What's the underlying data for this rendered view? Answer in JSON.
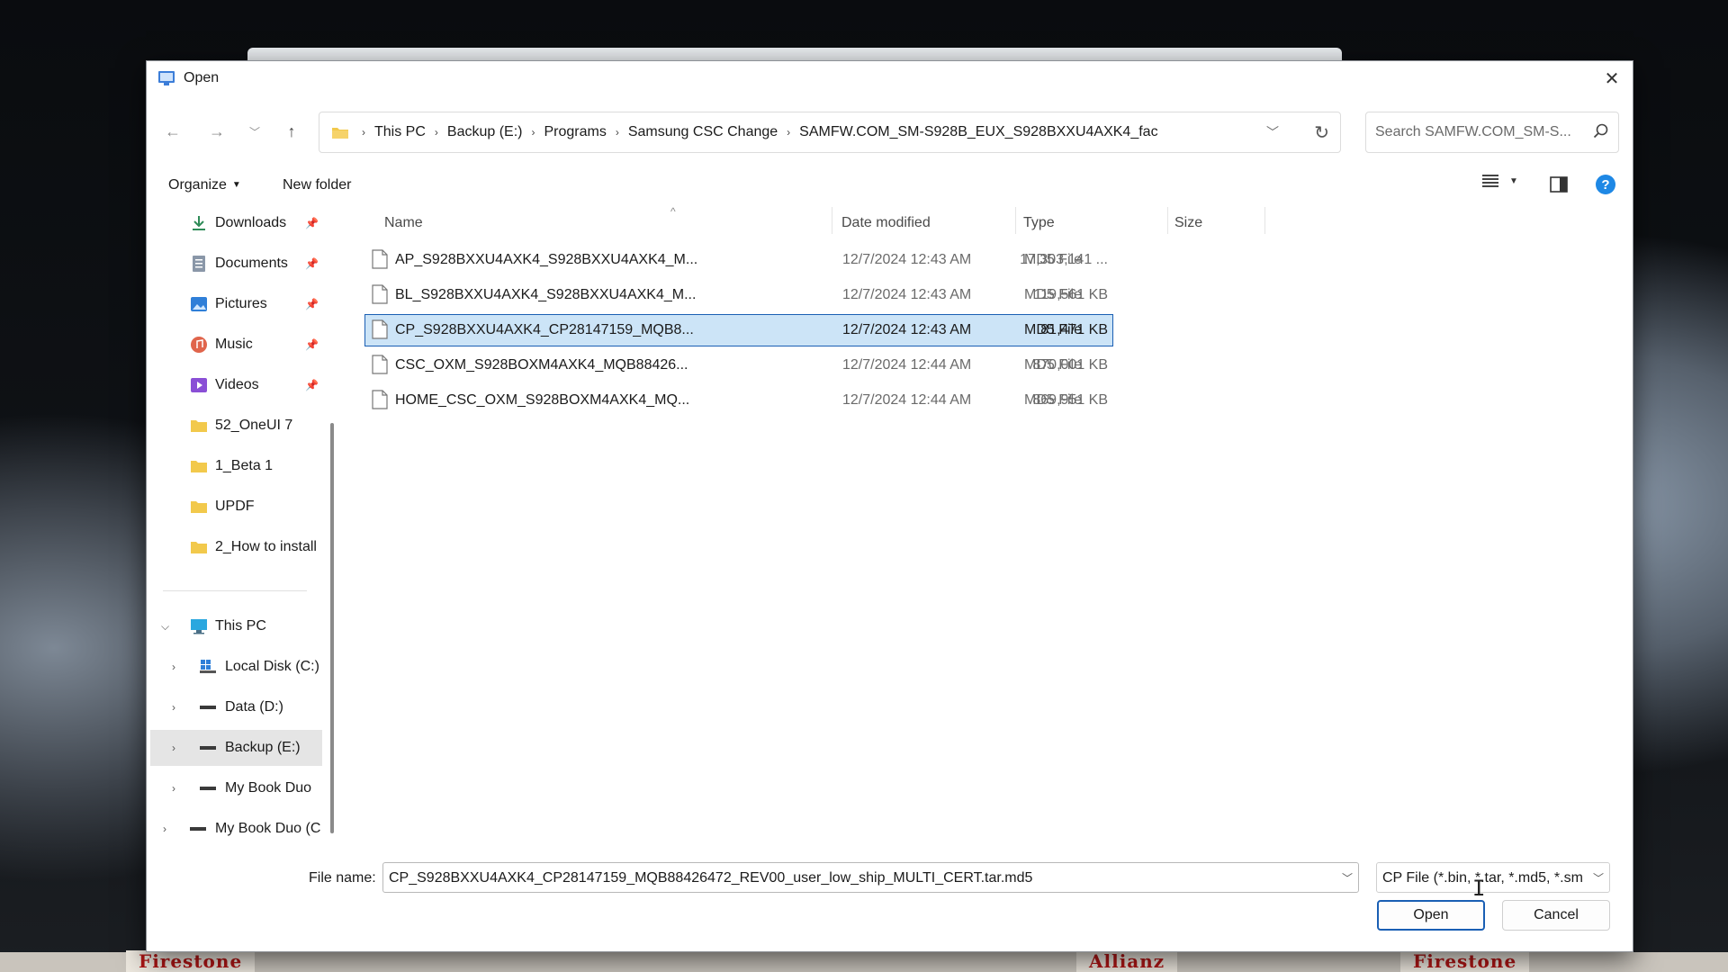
{
  "window": {
    "title": "Open"
  },
  "background": {
    "brand_left": "Firestone",
    "brand_center": "Allianz",
    "brand_right": "Firestone"
  },
  "address_bar": {
    "crumbs": [
      "This PC",
      "Backup (E:)",
      "Programs",
      "Samsung CSC Change",
      "SAMFW.COM_SM-S928B_EUX_S928BXXU4AXK4_fac"
    ]
  },
  "search": {
    "placeholder": "Search SAMFW.COM_SM-S..."
  },
  "commands": {
    "organize": "Organize",
    "new_folder": "New folder"
  },
  "sidebar": {
    "quick": [
      {
        "label": "Downloads",
        "icon": "download-icon",
        "pinned": true
      },
      {
        "label": "Documents",
        "icon": "document-icon",
        "pinned": true
      },
      {
        "label": "Pictures",
        "icon": "pictures-icon",
        "pinned": true
      },
      {
        "label": "Music",
        "icon": "music-icon",
        "pinned": true
      },
      {
        "label": "Videos",
        "icon": "videos-icon",
        "pinned": true
      },
      {
        "label": "52_OneUI 7",
        "icon": "folder-icon",
        "pinned": false
      },
      {
        "label": "1_Beta 1",
        "icon": "folder-icon",
        "pinned": false
      },
      {
        "label": "UPDF",
        "icon": "folder-icon",
        "pinned": false
      },
      {
        "label": "2_How to install",
        "icon": "folder-icon",
        "pinned": false
      }
    ],
    "tree": [
      {
        "label": "This PC",
        "icon": "computer-icon",
        "expanded": true
      },
      {
        "label": "Local Disk (C:)",
        "icon": "windows-drive-icon"
      },
      {
        "label": "Data (D:)",
        "icon": "drive-icon"
      },
      {
        "label": "Backup (E:)",
        "icon": "drive-icon",
        "selected": true
      },
      {
        "label": "My Book Duo",
        "icon": "drive-icon"
      },
      {
        "label": "My Book Duo (C",
        "icon": "drive-icon"
      }
    ]
  },
  "columns": {
    "name": "Name",
    "date": "Date modified",
    "type": "Type",
    "size": "Size"
  },
  "files": [
    {
      "name": "AP_S928BXXU4AXK4_S928BXXU4AXK4_M...",
      "date": "12/7/2024 12:43 AM",
      "type": "MD5 File",
      "size": "17,303,141 ..."
    },
    {
      "name": "BL_S928BXXU4AXK4_S928BXXU4AXK4_M...",
      "date": "12/7/2024 12:43 AM",
      "type": "MD5 File",
      "size": "119,561 KB"
    },
    {
      "name": "CP_S928BXXU4AXK4_CP28147159_MQB8...",
      "date": "12/7/2024 12:43 AM",
      "type": "MD5 File",
      "size": "81,471 KB",
      "selected": true
    },
    {
      "name": "CSC_OXM_S928BOXM4AXK4_MQB88426...",
      "date": "12/7/2024 12:44 AM",
      "type": "MD5 File",
      "size": "870,001 KB"
    },
    {
      "name": "HOME_CSC_OXM_S928BOXM4AXK4_MQ...",
      "date": "12/7/2024 12:44 AM",
      "type": "MD5 File",
      "size": "869,951 KB"
    }
  ],
  "footer": {
    "file_name_label": "File name:",
    "file_name_value": "CP_S928BXXU4AXK4_CP28147159_MQB88426472_REV00_user_low_ship_MULTI_CERT.tar.md5",
    "file_type_value": "CP File (*.bin, *.tar, *.md5, *.sm",
    "open_label": "Open",
    "cancel_label": "Cancel"
  },
  "colors": {
    "accent": "#1a5fb4",
    "selection": "#cce4f7",
    "folder": "#f2c94c"
  }
}
